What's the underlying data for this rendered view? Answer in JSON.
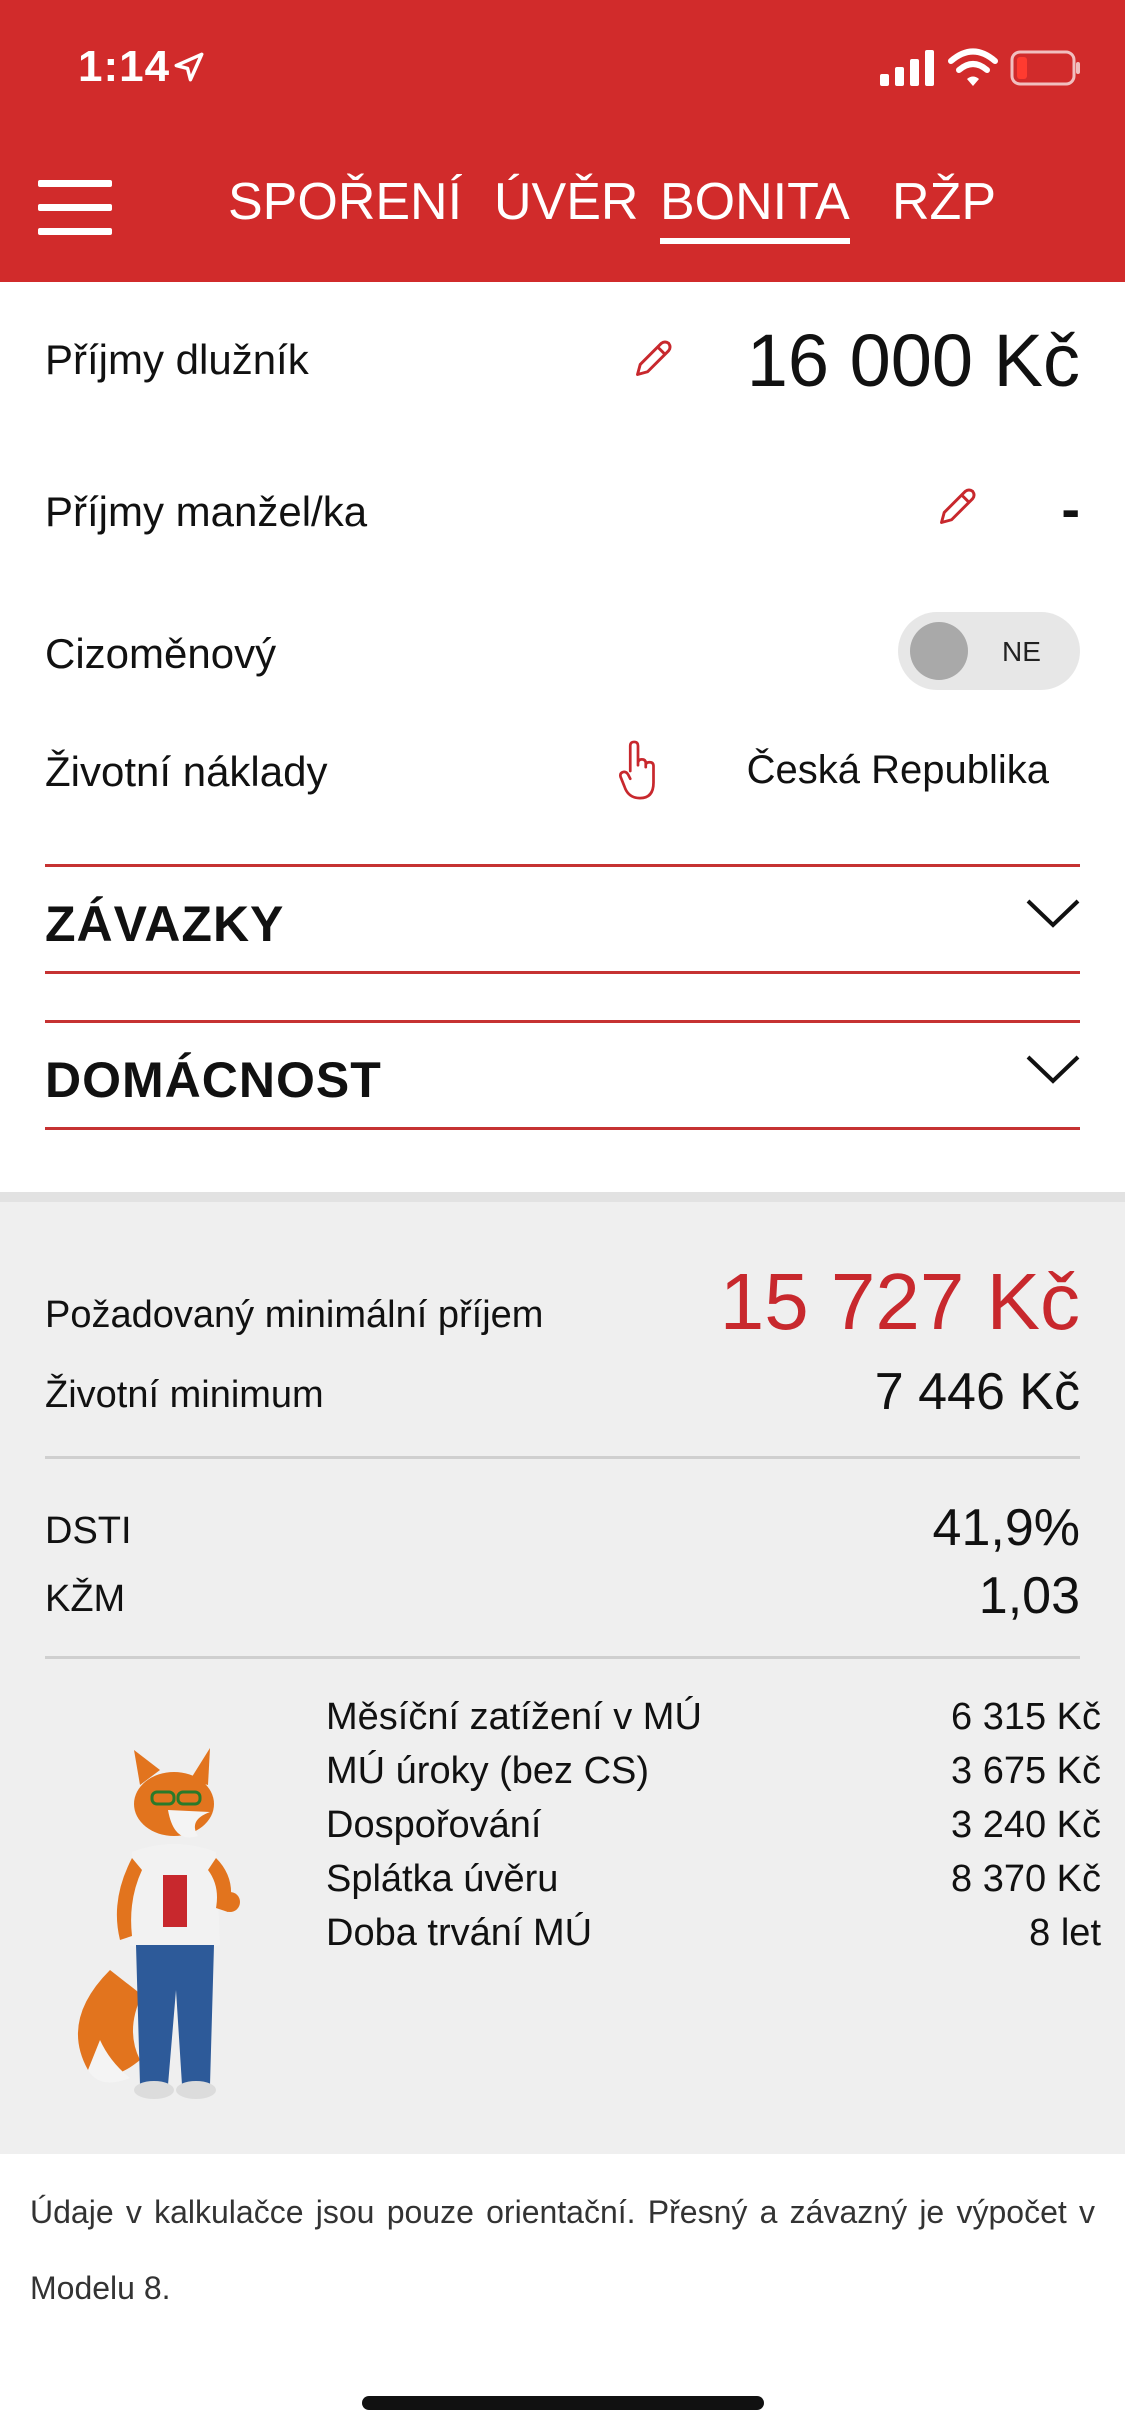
{
  "status_bar": {
    "time": "1:14",
    "icons": [
      "location-arrow-icon",
      "signal-icon",
      "wifi-icon",
      "battery-low-icon"
    ]
  },
  "nav": {
    "tabs": [
      {
        "label": "SPOŘENÍ",
        "active": false
      },
      {
        "label": "ÚVĚR",
        "active": false
      },
      {
        "label": "BONITA",
        "active": true
      },
      {
        "label": "RŽP",
        "active": false
      }
    ]
  },
  "form": {
    "income_debtor": {
      "label": "Příjmy dlužník",
      "value": "16 000 Kč"
    },
    "income_spouse": {
      "label": "Příjmy manžel/ka",
      "value": "-"
    },
    "foreign_currency": {
      "label": "Cizoměnový",
      "toggle": "NE"
    },
    "living_costs": {
      "label": "Životní náklady",
      "value": "Česká Republika"
    }
  },
  "sections": {
    "zavazky": "ZÁVAZKY",
    "domacnost": "DOMÁCNOST"
  },
  "summary": {
    "required_min_income": {
      "label": "Požadovaný minimální příjem",
      "value": "15 727 Kč"
    },
    "living_minimum": {
      "label": "Životní minimum",
      "value": "7 446 Kč"
    },
    "dsti": {
      "label": "DSTI",
      "value": "41,9%"
    },
    "kzm": {
      "label": "KŽM",
      "value": "1,03"
    },
    "details": [
      {
        "label": "Měsíční zatížení v MÚ",
        "value": "6 315 Kč"
      },
      {
        "label": "MÚ úroky (bez CS)",
        "value": "3 675 Kč"
      },
      {
        "label": "Dospořování",
        "value": "3 240 Kč"
      },
      {
        "label": "Splátka úvěru",
        "value": "8 370 Kč"
      },
      {
        "label": "Doba trvání MÚ",
        "value": "8 let"
      }
    ]
  },
  "disclaimer": "Údaje v kalkulačce jsou pouze orientační. Přesný a závazný je výpočet v Modelu 8.",
  "colors": {
    "brand_red": "#d12b2b",
    "value_red": "#c8282d"
  }
}
